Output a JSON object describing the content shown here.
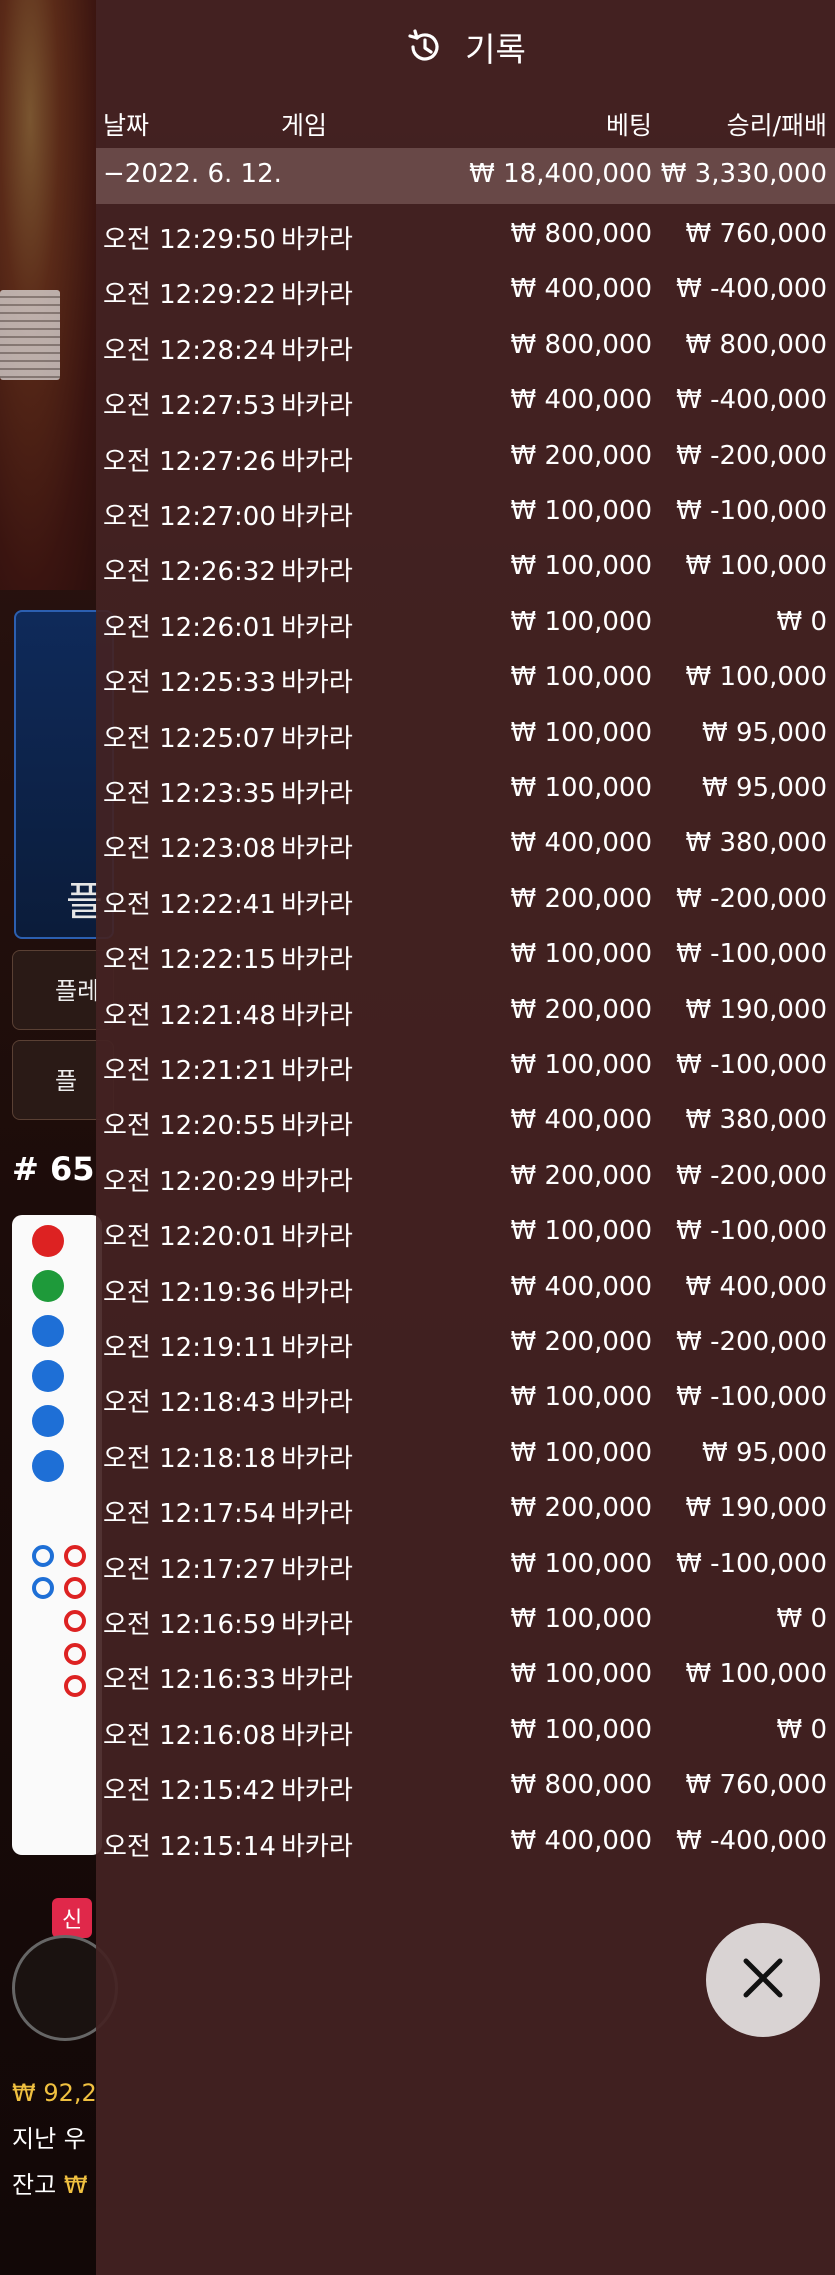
{
  "panel": {
    "title": "기록",
    "columns": {
      "date": "날짜",
      "game": "게임",
      "bet": "베팅",
      "result": "승리/패배"
    },
    "summary": {
      "date": "−2022. 6. 12.",
      "bet": "₩ 18,400,000",
      "result": "₩ 3,330,000"
    },
    "rows": [
      {
        "time": "오전 12:29:50",
        "game": "바카라",
        "bet": "₩ 800,000",
        "result": "₩ 760,000"
      },
      {
        "time": "오전 12:29:22",
        "game": "바카라",
        "bet": "₩ 400,000",
        "result": "₩ -400,000"
      },
      {
        "time": "오전 12:28:24",
        "game": "바카라",
        "bet": "₩ 800,000",
        "result": "₩ 800,000"
      },
      {
        "time": "오전 12:27:53",
        "game": "바카라",
        "bet": "₩ 400,000",
        "result": "₩ -400,000"
      },
      {
        "time": "오전 12:27:26",
        "game": "바카라",
        "bet": "₩ 200,000",
        "result": "₩ -200,000"
      },
      {
        "time": "오전 12:27:00",
        "game": "바카라",
        "bet": "₩ 100,000",
        "result": "₩ -100,000"
      },
      {
        "time": "오전 12:26:32",
        "game": "바카라",
        "bet": "₩ 100,000",
        "result": "₩ 100,000"
      },
      {
        "time": "오전 12:26:01",
        "game": "바카라",
        "bet": "₩ 100,000",
        "result": "₩ 0"
      },
      {
        "time": "오전 12:25:33",
        "game": "바카라",
        "bet": "₩ 100,000",
        "result": "₩ 100,000"
      },
      {
        "time": "오전 12:25:07",
        "game": "바카라",
        "bet": "₩ 100,000",
        "result": "₩ 95,000"
      },
      {
        "time": "오전 12:23:35",
        "game": "바카라",
        "bet": "₩ 100,000",
        "result": "₩ 95,000"
      },
      {
        "time": "오전 12:23:08",
        "game": "바카라",
        "bet": "₩ 400,000",
        "result": "₩ 380,000"
      },
      {
        "time": "오전 12:22:41",
        "game": "바카라",
        "bet": "₩ 200,000",
        "result": "₩ -200,000"
      },
      {
        "time": "오전 12:22:15",
        "game": "바카라",
        "bet": "₩ 100,000",
        "result": "₩ -100,000"
      },
      {
        "time": "오전 12:21:48",
        "game": "바카라",
        "bet": "₩ 200,000",
        "result": "₩ 190,000"
      },
      {
        "time": "오전 12:21:21",
        "game": "바카라",
        "bet": "₩ 100,000",
        "result": "₩ -100,000"
      },
      {
        "time": "오전 12:20:55",
        "game": "바카라",
        "bet": "₩ 400,000",
        "result": "₩ 380,000"
      },
      {
        "time": "오전 12:20:29",
        "game": "바카라",
        "bet": "₩ 200,000",
        "result": "₩ -200,000"
      },
      {
        "time": "오전 12:20:01",
        "game": "바카라",
        "bet": "₩ 100,000",
        "result": "₩ -100,000"
      },
      {
        "time": "오전 12:19:36",
        "game": "바카라",
        "bet": "₩ 400,000",
        "result": "₩ 400,000"
      },
      {
        "time": "오전 12:19:11",
        "game": "바카라",
        "bet": "₩ 200,000",
        "result": "₩ -200,000"
      },
      {
        "time": "오전 12:18:43",
        "game": "바카라",
        "bet": "₩ 100,000",
        "result": "₩ -100,000"
      },
      {
        "time": "오전 12:18:18",
        "game": "바카라",
        "bet": "₩ 100,000",
        "result": "₩ 95,000"
      },
      {
        "time": "오전 12:17:54",
        "game": "바카라",
        "bet": "₩ 200,000",
        "result": "₩ 190,000"
      },
      {
        "time": "오전 12:17:27",
        "game": "바카라",
        "bet": "₩ 100,000",
        "result": "₩ -100,000"
      },
      {
        "time": "오전 12:16:59",
        "game": "바카라",
        "bet": "₩ 100,000",
        "result": "₩ 0"
      },
      {
        "time": "오전 12:16:33",
        "game": "바카라",
        "bet": "₩ 100,000",
        "result": "₩ 100,000"
      },
      {
        "time": "오전 12:16:08",
        "game": "바카라",
        "bet": "₩ 100,000",
        "result": "₩ 0"
      },
      {
        "time": "오전 12:15:42",
        "game": "바카라",
        "bet": "₩ 800,000",
        "result": "₩ 760,000"
      },
      {
        "time": "오전 12:15:14",
        "game": "바카라",
        "bet": "₩ 400,000",
        "result": "₩ -400,000"
      }
    ]
  },
  "background": {
    "player_panel_label": "플",
    "button_1_label": "플레",
    "button_2_label": "플",
    "round_number": "# 65",
    "new_badge": "신",
    "balance_line": "₩ 92,2",
    "last_win_label": "지난 우",
    "balance_label": "잔고",
    "balance_prefix": "₩"
  },
  "colors": {
    "panel": "#442222",
    "summary": "#967876",
    "close_button": "#d9d3d3"
  },
  "icons": {
    "history": "history-icon",
    "close": "close-icon"
  }
}
